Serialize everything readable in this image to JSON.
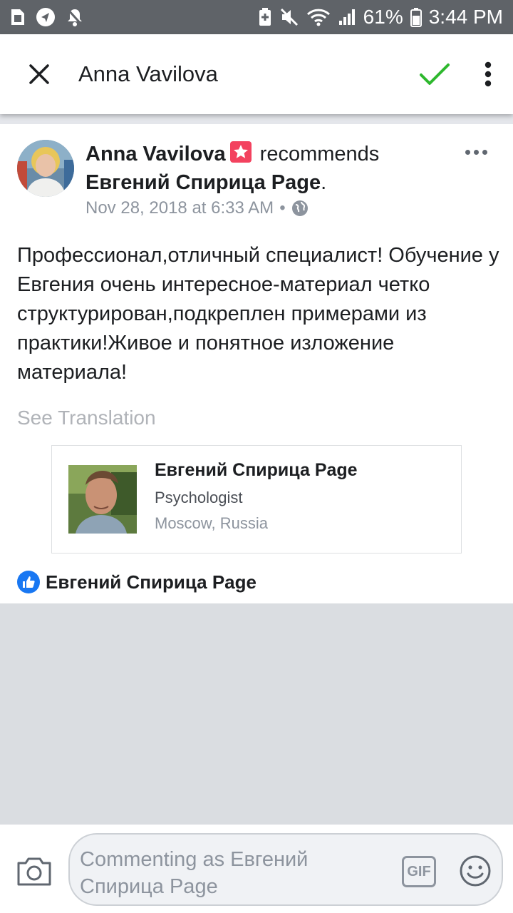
{
  "status_bar": {
    "battery_percent": "61%",
    "time": "3:44 PM",
    "icons_left": [
      "sim-card-icon",
      "navigation-icon",
      "notifications-off-icon"
    ],
    "icons_right": [
      "battery-saver-icon",
      "mute-icon",
      "wifi-icon",
      "signal-icon",
      "battery-icon"
    ]
  },
  "app_bar": {
    "title": "Anna Vavilova",
    "close_icon": "close-icon",
    "confirm_icon": "checkmark-icon",
    "more_icon": "more-vertical-icon",
    "accent_color": "#2eb82e"
  },
  "post": {
    "author": "Anna Vavilova",
    "action": "recommends",
    "page": "Евгений Спирица Page",
    "punctuation": ".",
    "timestamp": "Nov 28, 2018 at 6:33 AM",
    "separator": "•",
    "privacy_icon": "globe-icon",
    "body": "Профессионал,отличный специалист! Обучение у Евгения очень интересное-материал четко структурирован,подкреплен примерами из практики!Живое и понятное изложение материала!",
    "see_translation": "See Translation"
  },
  "card": {
    "name": "Евгений Спирица Page",
    "category": "Psychologist",
    "location": "Moscow, Russia"
  },
  "recommender_line": {
    "name": "Евгений Спирица Page",
    "like_color": "#1877f2"
  },
  "composer": {
    "placeholder": "Commenting as Евгений Спирица Page",
    "gif_label": "GIF",
    "camera_icon": "camera-icon",
    "emoji_icon": "emoji-icon"
  }
}
